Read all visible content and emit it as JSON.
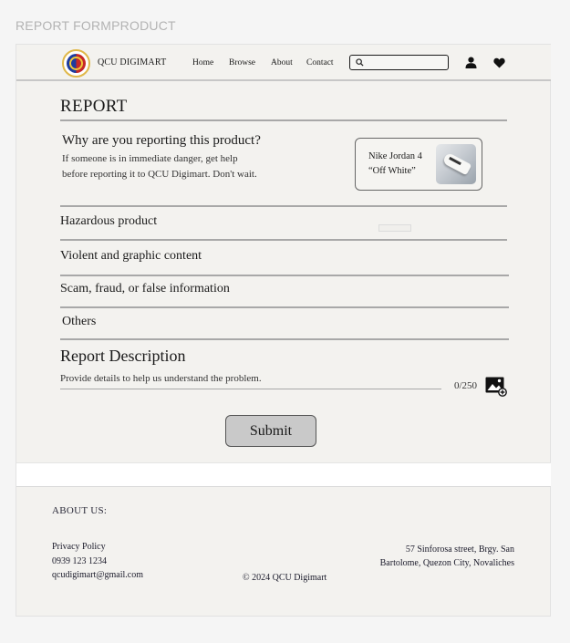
{
  "frame_label": "REPORT FORMPRODUCT",
  "navbar": {
    "brand": "QCU DIGIMART",
    "links": [
      "Home",
      "Browse",
      "About",
      "Contact"
    ],
    "search_placeholder": "",
    "icons": [
      "search-icon",
      "user-icon",
      "heart-icon"
    ]
  },
  "report": {
    "title": "REPORT",
    "question": "Why are you reporting this product?",
    "description": "If someone is in immediate danger, get help before reporting it to QCU Digimart. Don't wait.",
    "product": {
      "name_line1": "Nike Jordan 4",
      "name_line2": "“Off White”"
    },
    "reasons": [
      "Hazardous product",
      "Violent and graphic content",
      "Scam, fraud, or false information",
      "Others"
    ],
    "description_section": {
      "title": "Report Description",
      "placeholder": "Provide details to help us understand the problem.",
      "counter": "0/250"
    },
    "submit_label": "Submit"
  },
  "footer": {
    "about_label": "ABOUT US:",
    "links": [
      "Privacy Policy",
      "0939 123 1234",
      "qcudigimart@gmail.com"
    ],
    "copyright": "© 2024 QCU Digimart",
    "address": "57 Sinforosa street, Brgy. San Bartolome, Quezon City, Novaliches"
  },
  "colors": {
    "frame_bg": "#f3f2ef",
    "divider": "#a8a8a8",
    "submit_bg": "#c9c9c9",
    "footer_text": "#1a1a2a"
  }
}
